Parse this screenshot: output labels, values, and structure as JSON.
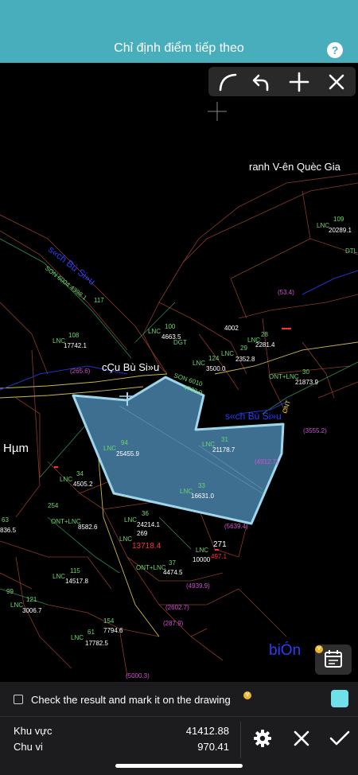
{
  "header": {
    "title": "Chỉ định điểm tiếp theo",
    "help_label": "?"
  },
  "toolbar": {
    "tools": [
      "curve-icon",
      "undo-icon",
      "plus-icon",
      "close-icon"
    ]
  },
  "map": {
    "labels": {
      "road_national": "ranh V-ên Quèc Gia",
      "cau_bu_sieu": "cÇu Bù Si»u",
      "hum": "Hµm",
      "suoi_bu_sieu_left": "s«ch Bù Si»u",
      "suoi_bu_sieu_right": "s«ch Bù Si»u",
      "bien": "biÓn",
      "son_left": "SON 6004  4398.1",
      "son_mid": "SON  6010",
      "son_mid_area": "4778.9",
      "ont_right": "ONT"
    },
    "parcels": [
      {
        "num": "109",
        "type": "LNC",
        "area": "20289.1"
      },
      {
        "num": "DTL",
        "type": "",
        "area": ""
      },
      {
        "num": "117",
        "type": "",
        "area": ""
      },
      {
        "num": "108",
        "type": "LNC",
        "area": "17742.1"
      },
      {
        "num": "100",
        "type": "LNC",
        "area": "4663.5"
      },
      {
        "num": "DGT",
        "type": "",
        "area": ""
      },
      {
        "num": "4002",
        "type": "",
        "area": ""
      },
      {
        "num": "28",
        "type": "LNC",
        "area": "2281.4"
      },
      {
        "num": "29",
        "type": "LNC",
        "area": "2352.8"
      },
      {
        "num": "124",
        "type": "LNC",
        "area": "3500.0"
      },
      {
        "num": "30",
        "type": "ONT+LNC",
        "area": "21873.9"
      },
      {
        "num": "94",
        "type": "LNC",
        "area": "25455.9"
      },
      {
        "num": "31",
        "type": "LNC",
        "area": "21178.7"
      },
      {
        "num": "33",
        "type": "LNC",
        "area": "16631.0"
      },
      {
        "num": "34",
        "type": "LNC",
        "area": "4505.2"
      },
      {
        "num": "254",
        "type": "ONT+LNC",
        "area": "8582.6"
      },
      {
        "num": "36",
        "type": "LNC",
        "area": "24214.1"
      },
      {
        "num": "269",
        "type": "LNC",
        "area": "13718.4"
      },
      {
        "num": "271",
        "type": "LNC",
        "area": "10000"
      },
      {
        "num": "115",
        "type": "LNC",
        "area": "14517.8"
      },
      {
        "num": "37",
        "type": "ONT+LNC",
        "area": "4474.5"
      },
      {
        "num": "121",
        "type": "LNC",
        "area": "3006.7"
      },
      {
        "num": "154",
        "type": "LNC",
        "area": "7794.6"
      },
      {
        "num": "61",
        "type": "LNC",
        "area": "17782.5"
      },
      {
        "num": "63",
        "type": "",
        "area": "836.5"
      },
      {
        "num": "99",
        "type": "",
        "area": ""
      }
    ],
    "annotations": [
      "(53.4)",
      "(265.6)",
      "(3555.2)",
      "(4912.7)",
      "(5639.4)",
      "(4939.9)",
      "(2602.7)",
      "(287.9)",
      "(5000.3)",
      "497.1"
    ]
  },
  "check": {
    "label": "Check the result and mark it on the drawing",
    "badge": "V"
  },
  "stats": {
    "area_label": "Khu vực",
    "area_value": "41412.88",
    "perimeter_label": "Chu vi",
    "perimeter_value": "970.41"
  },
  "colors": {
    "header": "#49aebc",
    "polygon_fill": "#3f6f90",
    "polygon_stroke": "#9fd7ea",
    "swatch": "#6fe0ea"
  }
}
